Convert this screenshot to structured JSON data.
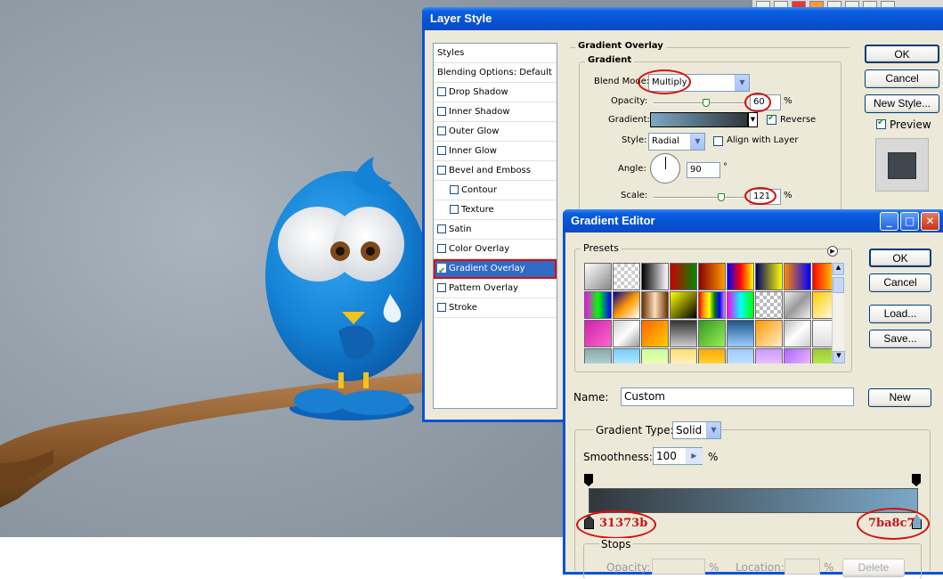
{
  "layer_style": {
    "title": "Layer Style",
    "styles_header": "Styles",
    "blending_options": "Blending Options: Default",
    "items": [
      {
        "label": "Drop Shadow",
        "checked": false,
        "indent": false
      },
      {
        "label": "Inner Shadow",
        "checked": false,
        "indent": false
      },
      {
        "label": "Outer Glow",
        "checked": false,
        "indent": false
      },
      {
        "label": "Inner Glow",
        "checked": false,
        "indent": false
      },
      {
        "label": "Bevel and Emboss",
        "checked": false,
        "indent": false
      },
      {
        "label": "Contour",
        "checked": false,
        "indent": true
      },
      {
        "label": "Texture",
        "checked": false,
        "indent": true
      },
      {
        "label": "Satin",
        "checked": false,
        "indent": false
      },
      {
        "label": "Color Overlay",
        "checked": false,
        "indent": false
      },
      {
        "label": "Gradient Overlay",
        "checked": true,
        "indent": false,
        "selected": true
      },
      {
        "label": "Pattern Overlay",
        "checked": false,
        "indent": false
      },
      {
        "label": "Stroke",
        "checked": false,
        "indent": false
      }
    ],
    "section_title": "Gradient Overlay",
    "group_title": "Gradient",
    "blend_mode_label": "Blend Mode:",
    "blend_mode_value": "Multiply",
    "opacity_label": "Opacity:",
    "opacity_value": "60",
    "opacity_unit": "%",
    "gradient_label": "Gradient:",
    "reverse_label": "Reverse",
    "reverse_checked": true,
    "style_label": "Style:",
    "style_value": "Radial",
    "align_label": "Align with Layer",
    "align_checked": false,
    "angle_label": "Angle:",
    "angle_value": "90",
    "angle_unit": "°",
    "scale_label": "Scale:",
    "scale_value": "121",
    "scale_unit": "%",
    "ok": "OK",
    "cancel": "Cancel",
    "new_style": "New Style...",
    "preview_label": "Preview",
    "preview_checked": true
  },
  "gradient_editor": {
    "title": "Gradient Editor",
    "presets_label": "Presets",
    "ok": "OK",
    "cancel": "Cancel",
    "load": "Load...",
    "save": "Save...",
    "name_label": "Name:",
    "name_value": "Custom",
    "new_button": "New",
    "gradient_type_label": "Gradient Type:",
    "gradient_type_value": "Solid",
    "smoothness_label": "Smoothness:",
    "smoothness_value": "100",
    "smoothness_unit": "%",
    "stop_left_color": "31373b",
    "stop_right_color": "7ba8c7",
    "stops_label": "Stops",
    "opacity_label": "Opacity:",
    "opacity_unit": "%",
    "location_label": "Location:",
    "location_unit": "%",
    "delete_label": "Delete"
  },
  "colors": {
    "gradient_start": "#31373b",
    "gradient_end": "#7ba8c7",
    "bird_blue": "#1a8ad8",
    "branch": "#7a4f23"
  }
}
